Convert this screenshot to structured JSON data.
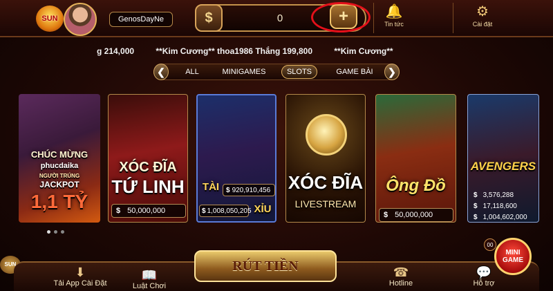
{
  "header": {
    "logo_text": "SUN",
    "username": "GenosDayNe",
    "currency_symbol": "$",
    "balance": "0",
    "add_symbol": "+",
    "news_label": "Tin tức",
    "settings_label": "Cài đặt"
  },
  "ticker": [
    "g 214,000",
    "**Kim Cương** thoa1986 Thắng 199,800",
    "**Kim Cương**"
  ],
  "tabs": {
    "prev": "❮",
    "next": "❯",
    "items": [
      {
        "label": "ALL",
        "active": false
      },
      {
        "label": "MINIGAMES",
        "active": false
      },
      {
        "label": "SLOTS",
        "active": true
      },
      {
        "label": "GAME BÀI",
        "active": false
      }
    ]
  },
  "cards": {
    "jackpot": {
      "line1": "CHÚC MỪNG",
      "line2": "phucdaika",
      "line3": "NGƯỜI TRÚNG",
      "line4": "JACKPOT",
      "line5": "1,1 TỶ"
    },
    "xoc_dia_tu_linh": {
      "title_top": "XÓC ĐĨA",
      "title_bottom": "TỨ LINH",
      "currency": "$",
      "amount": "50,000,000"
    },
    "tai_xiu": {
      "tai": "TÀI",
      "xiu": "XỈU",
      "tai_amount": "920,910,456",
      "xiu_amount": "1,008,050,205",
      "currency": "$"
    },
    "xoc_dia_live": {
      "title": "XÓC ĐĨA",
      "subtitle": "LIVESTREAM"
    },
    "ong_do": {
      "title": "Ông Đồ",
      "currency": "$",
      "amount": "50,000,000"
    },
    "avengers": {
      "title": "AVENGERS",
      "currency": "$",
      "amounts": [
        "3,576,288",
        "17,118,600",
        "1,004,602,000"
      ]
    }
  },
  "bottom": {
    "download_label": "Tải App Cài Đặt",
    "rules_label": "Luật Chơi",
    "withdraw_label": "RÚT TIỀN",
    "hotline_label": "Hotline",
    "support_label": "Hỗ trợ",
    "minigame_line1": "MINI",
    "minigame_line2": "GAME",
    "minigame_count": "00"
  },
  "colors": {
    "accent_gold": "#e5b35a",
    "highlight_red": "#e3101a",
    "background": "#1e0805"
  }
}
